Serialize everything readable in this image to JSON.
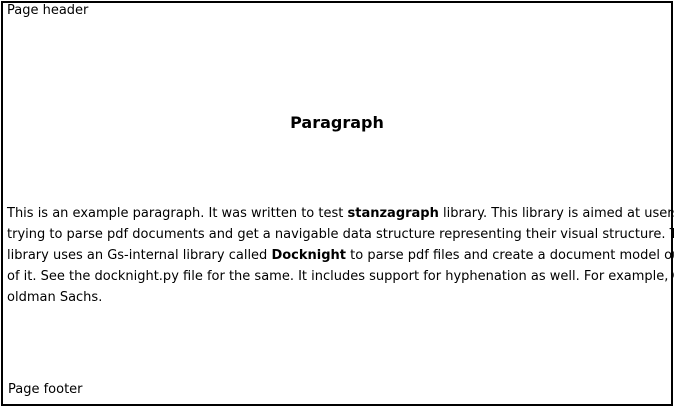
{
  "page": {
    "header": "Page header",
    "footer": "Page footer",
    "title": "Paragraph"
  },
  "paragraph": {
    "line1": {
      "pre": "This is an example paragraph. It was written to test ",
      "bold": "stanzagraph",
      "post": " library. This library is aimed at users"
    },
    "line2": "trying to parse pdf documents and get a navigable data structure representing their visual structure. The",
    "line3": {
      "pre": "library uses an Gs-internal library called ",
      "bold": "Docknight",
      "post": " to parse pdf files and create a document model out"
    },
    "line4": "of it. See the docknight.py file for the same. It includes support for hyphenation as well. For example, G-",
    "line5": "oldman Sachs."
  }
}
